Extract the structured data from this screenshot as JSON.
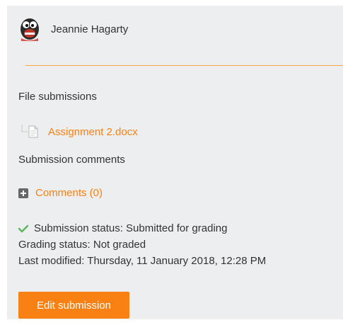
{
  "user": {
    "name": "Jeannie Hagarty",
    "avatar_icon": "cartoon-face-avatar"
  },
  "file_submissions": {
    "label": "File submissions",
    "files": [
      {
        "name": "Assignment 2.docx",
        "icon": "file-icon"
      }
    ]
  },
  "submission_comments": {
    "label": "Submission comments",
    "comments_link": "Comments (0)",
    "expand_icon": "plus-icon"
  },
  "status": {
    "submission": "Submission status: Submitted for grading",
    "grading": "Grading status: Not graded",
    "last_modified": "Last modified: Thursday, 11 January 2018, 12:28 PM",
    "check_icon": "checkmark-icon"
  },
  "actions": {
    "edit_label": "Edit submission"
  },
  "colors": {
    "accent": "#f98012",
    "divider": "#f7a645",
    "panel_bg": "#eceeef",
    "check": "#5cb85c"
  }
}
